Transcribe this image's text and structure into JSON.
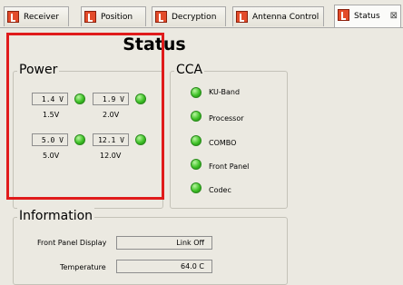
{
  "tabs": [
    {
      "label": "Receiver"
    },
    {
      "label": "Position"
    },
    {
      "label": "Decryption"
    },
    {
      "label": "Antenna Control"
    },
    {
      "label": "Status",
      "close": "⊠"
    }
  ],
  "page_title": "Status",
  "power": {
    "title": "Power",
    "readouts": [
      {
        "value": "1.4 V",
        "label": "1.5V"
      },
      {
        "value": "1.9 V",
        "label": "2.0V"
      },
      {
        "value": "5.0 V",
        "label": "5.0V"
      },
      {
        "value": "12.1 V",
        "label": "12.0V"
      }
    ]
  },
  "cca": {
    "title": "CCA",
    "items": [
      {
        "label": "KU-Band"
      },
      {
        "label": "Processor"
      },
      {
        "label": "COMBO"
      },
      {
        "label": "Front Panel"
      },
      {
        "label": "Codec"
      }
    ]
  },
  "information": {
    "title": "Information",
    "front_panel_label": "Front Panel Display",
    "front_panel_value": "Link Off",
    "temperature_label": "Temperature",
    "temperature_value": "64.0 C"
  },
  "colors": {
    "led_ok": "#3fc227",
    "highlight": "#e01b1b"
  }
}
